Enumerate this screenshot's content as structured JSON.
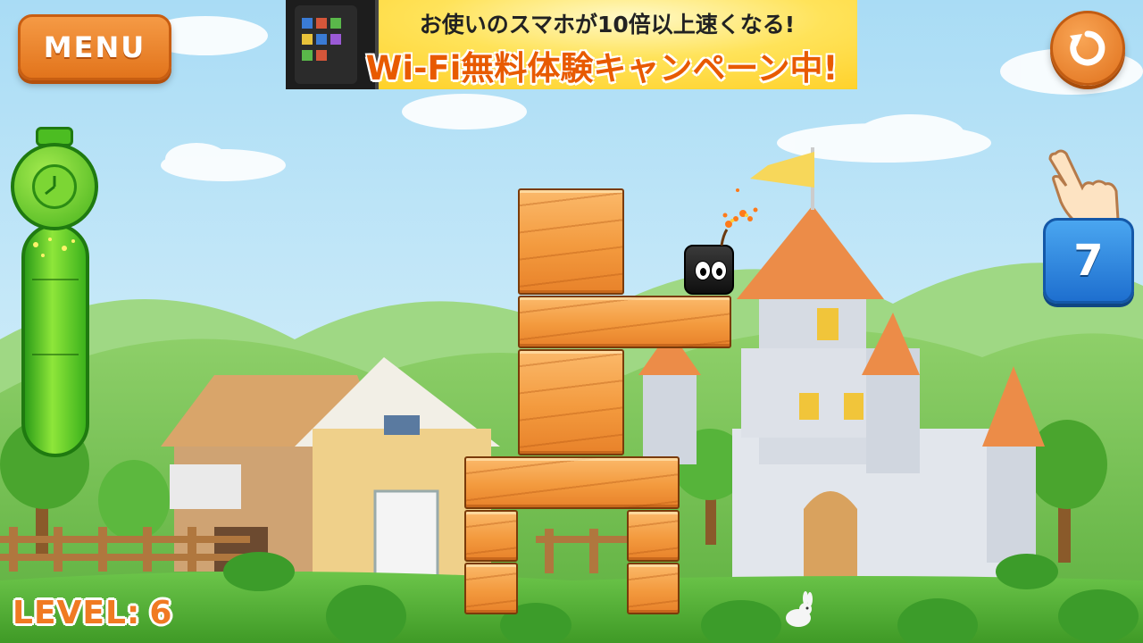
{
  "menu_button": {
    "label": "MENU"
  },
  "restart_button": {
    "icon": "restart-icon"
  },
  "ad_banner": {
    "line1": "お使いのスマホが10倍以上速くなる!",
    "line2": "Wi-Fi無料体験キャンペーン中!"
  },
  "level": {
    "label": "LEVEL:",
    "value": "6"
  },
  "tap_counter": {
    "value": "7",
    "icon": "tap-hand-icon"
  },
  "timer": {
    "icon": "stopwatch-icon",
    "segments": 3
  },
  "colors": {
    "sky": "#bfe6f8",
    "accent_orange": "#e9801e",
    "timer_green": "#46b21c",
    "counter_blue": "#2b84dd",
    "block_orange": "#f39a3e"
  }
}
